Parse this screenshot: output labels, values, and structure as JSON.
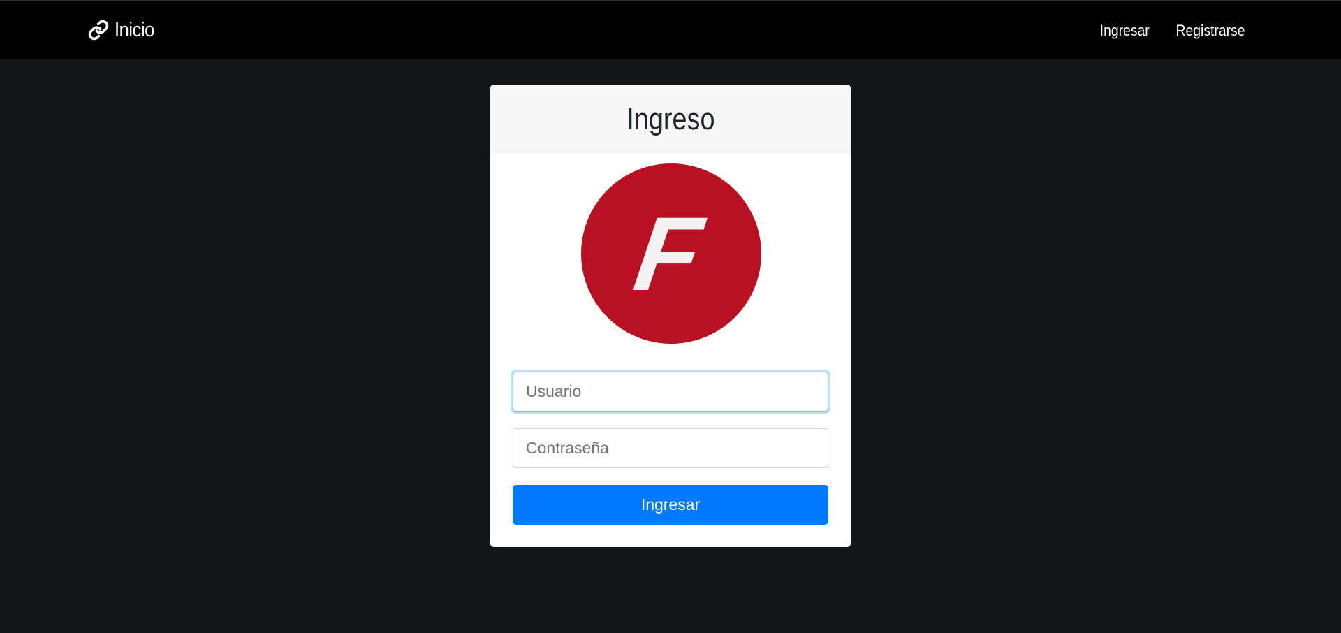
{
  "navbar": {
    "brand_icon": "link-icon",
    "brand_label": "Inicio",
    "links": [
      {
        "label": "Ingresar"
      },
      {
        "label": "Registrarse"
      }
    ]
  },
  "login_card": {
    "title": "Ingreso",
    "logo": {
      "letter": "F",
      "color": "#b91022"
    },
    "username_placeholder": "Usuario",
    "password_placeholder": "Contraseña",
    "submit_label": "Ingresar"
  },
  "colors": {
    "page_background": "#141519",
    "navbar_background": "#000000",
    "primary": "#007bff"
  }
}
